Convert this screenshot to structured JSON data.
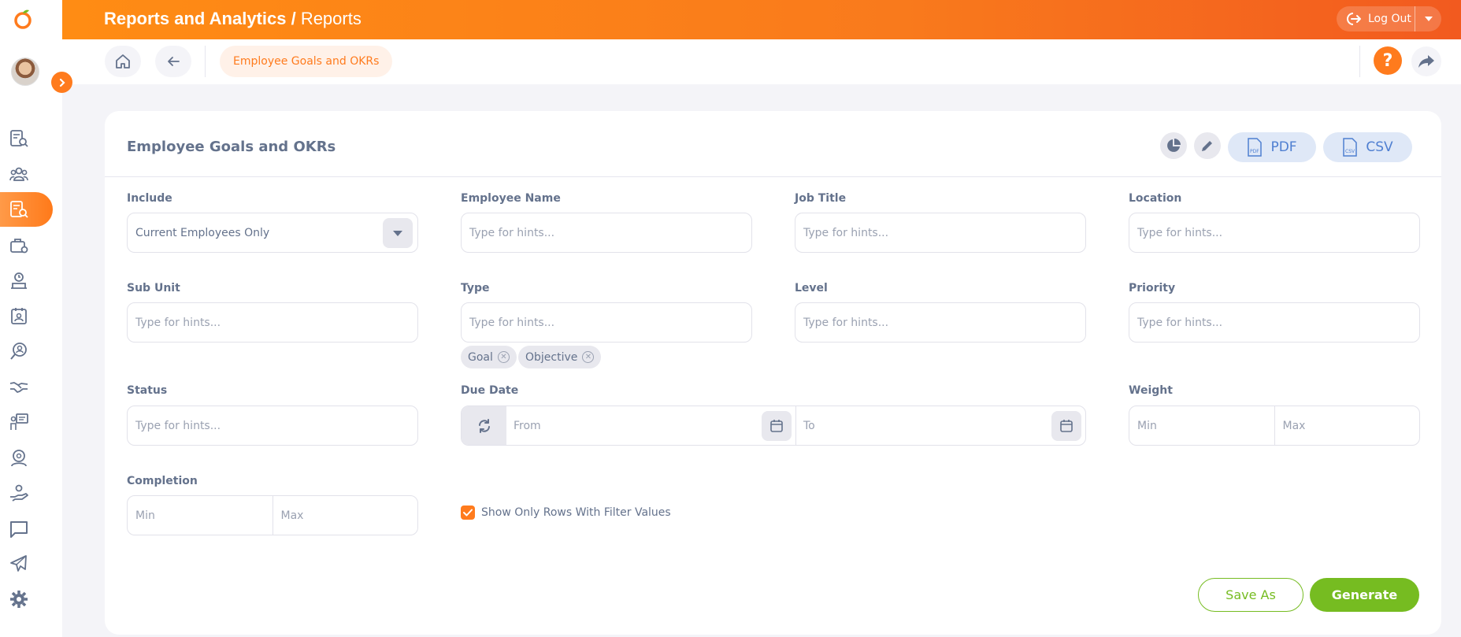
{
  "header": {
    "module": "Reports and Analytics",
    "separator": " / ",
    "page": "Reports",
    "logout_label": "Log Out"
  },
  "toolbar": {
    "breadcrumb_label": "Employee Goals and OKRs",
    "help_glyph": "?"
  },
  "sidebar": {
    "icons": [
      "reports-icon",
      "people-icon",
      "report-search-icon",
      "briefcase-settings-icon",
      "time-icon",
      "calendar-person-icon",
      "search-person-icon",
      "handshake-icon",
      "presentation-icon",
      "award-icon",
      "hand-coin-icon",
      "chat-icon",
      "plane-icon",
      "settings-icon"
    ],
    "active_index": 2
  },
  "card": {
    "title": "Employee Goals and OKRs",
    "pdf_label": "PDF",
    "csv_label": "CSV",
    "pdf_file_tag": "PDF",
    "csv_file_tag": "CSV"
  },
  "filters": {
    "include": {
      "label": "Include",
      "value": "Current Employees Only"
    },
    "employee_name": {
      "label": "Employee Name",
      "placeholder": "Type for hints..."
    },
    "job_title": {
      "label": "Job Title",
      "placeholder": "Type for hints..."
    },
    "location": {
      "label": "Location",
      "placeholder": "Type for hints..."
    },
    "sub_unit": {
      "label": "Sub Unit",
      "placeholder": "Type for hints..."
    },
    "type": {
      "label": "Type",
      "placeholder": "Type for hints...",
      "chips": [
        "Goal",
        "Objective"
      ]
    },
    "level": {
      "label": "Level",
      "placeholder": "Type for hints..."
    },
    "priority": {
      "label": "Priority",
      "placeholder": "Type for hints..."
    },
    "status": {
      "label": "Status",
      "placeholder": "Type for hints..."
    },
    "due_date": {
      "label": "Due Date",
      "from": "From",
      "to": "To"
    },
    "weight": {
      "label": "Weight",
      "min": "Min",
      "max": "Max"
    },
    "completion": {
      "label": "Completion",
      "min": "Min",
      "max": "Max"
    },
    "show_only_rows": {
      "label": "Show Only Rows With Filter Values",
      "checked": true
    }
  },
  "actions": {
    "save_as": "Save As",
    "generate": "Generate"
  },
  "colors": {
    "accent": "#ff7b1d",
    "success": "#76bc21",
    "text": "#64728c"
  }
}
